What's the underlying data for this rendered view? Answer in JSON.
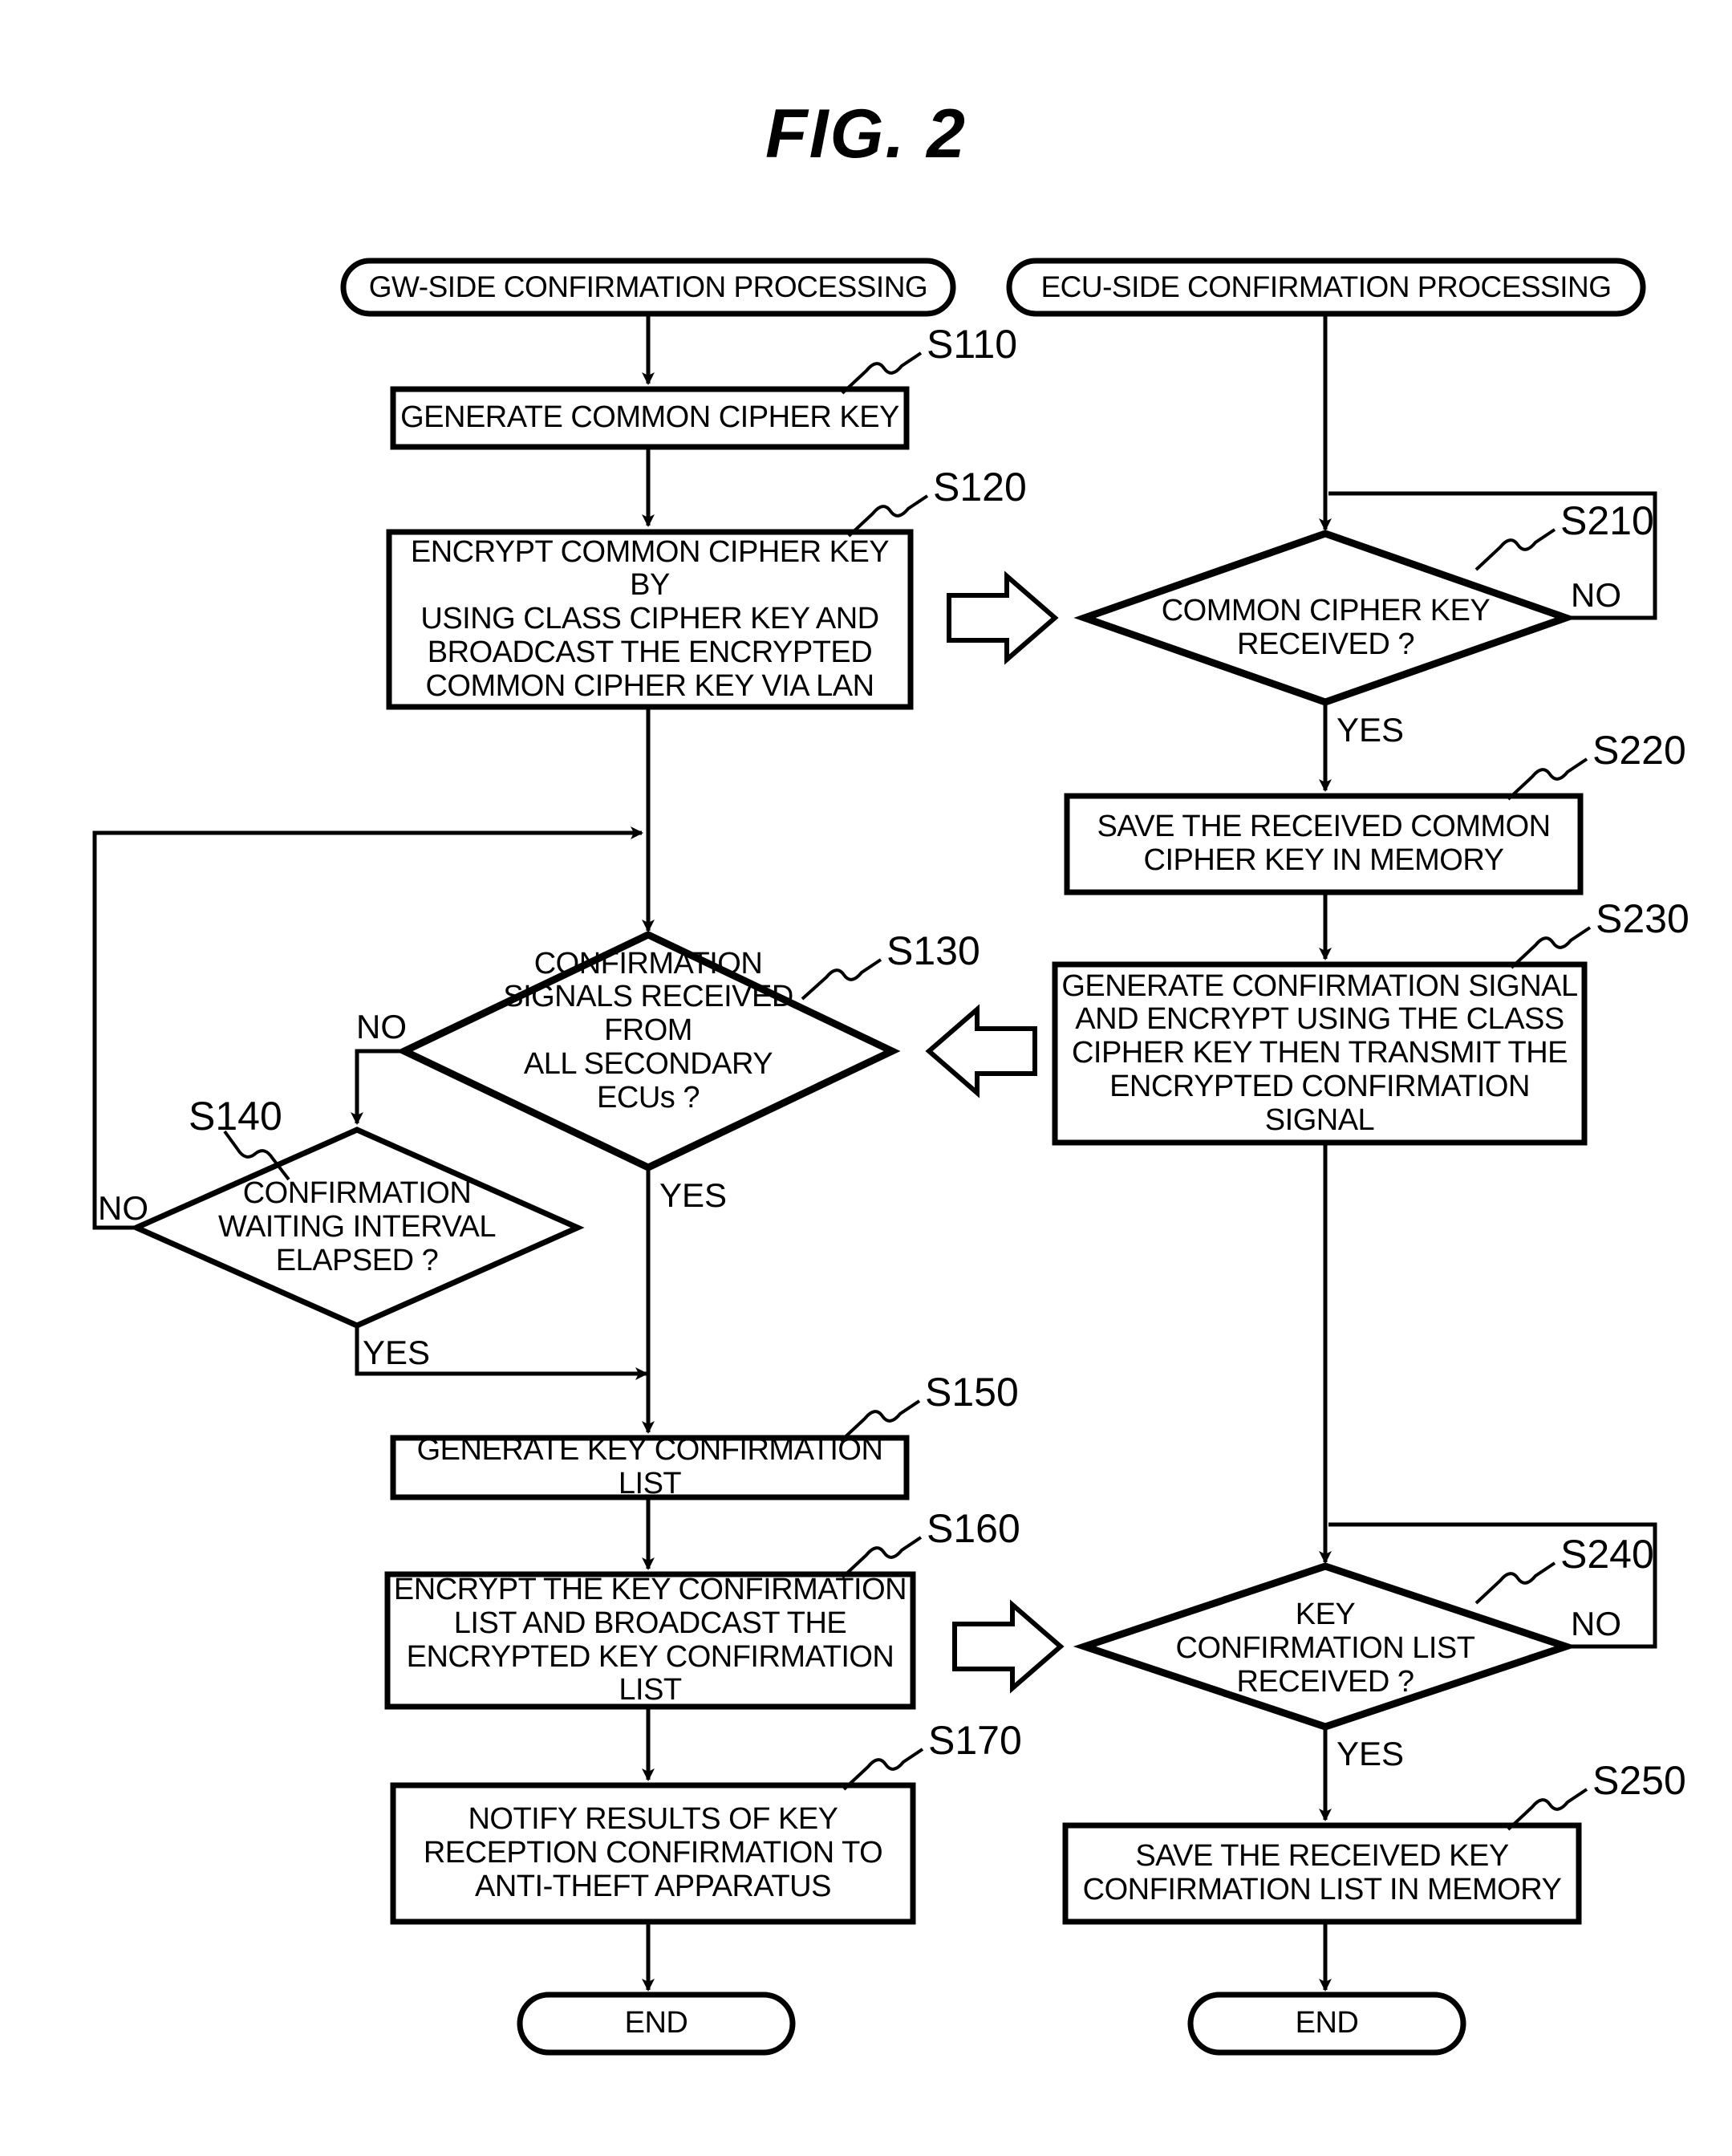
{
  "figure": {
    "title": "FIG.  2",
    "type": "flowchart",
    "lanes": [
      {
        "id": "gw",
        "start_label": "GW-SIDE CONFIRMATION PROCESSING"
      },
      {
        "id": "ecu",
        "start_label": "ECU-SIDE CONFIRMATION PROCESSING"
      }
    ]
  },
  "nodes": {
    "gw_start": {
      "shape": "terminator",
      "text": "GW-SIDE CONFIRMATION PROCESSING"
    },
    "ecu_start": {
      "shape": "terminator",
      "text": "ECU-SIDE CONFIRMATION PROCESSING"
    },
    "s110": {
      "shape": "process",
      "step": "S110",
      "text": "GENERATE COMMON CIPHER KEY"
    },
    "s120": {
      "shape": "process",
      "step": "S120",
      "text": "ENCRYPT COMMON CIPHER KEY BY\nUSING CLASS CIPHER KEY AND\nBROADCAST THE ENCRYPTED\nCOMMON CIPHER KEY VIA LAN"
    },
    "s130": {
      "shape": "decision",
      "step": "S130",
      "text": "CONFIRMATION\nSIGNALS RECEIVED FROM\nALL SECONDARY\nECUs ?",
      "yes": "YES",
      "no": "NO"
    },
    "s140": {
      "shape": "decision",
      "step": "S140",
      "text": "CONFIRMATION\nWAITING INTERVAL\nELAPSED ?",
      "yes": "YES",
      "no": "NO"
    },
    "s150": {
      "shape": "process",
      "step": "S150",
      "text": "GENERATE KEY CONFIRMATION LIST"
    },
    "s160": {
      "shape": "process",
      "step": "S160",
      "text": "ENCRYPT THE KEY CONFIRMATION\nLIST AND BROADCAST THE\nENCRYPTED KEY CONFIRMATION LIST"
    },
    "s170": {
      "shape": "process",
      "step": "S170",
      "text": "NOTIFY RESULTS OF KEY\nRECEPTION CONFIRMATION TO\nANTI-THEFT APPARATUS"
    },
    "gw_end": {
      "shape": "terminator",
      "text": "END"
    },
    "s210": {
      "shape": "decision",
      "step": "S210",
      "text": "COMMON CIPHER KEY\nRECEIVED ?",
      "yes": "YES",
      "no": "NO"
    },
    "s220": {
      "shape": "process",
      "step": "S220",
      "text": "SAVE THE RECEIVED COMMON\nCIPHER KEY IN MEMORY"
    },
    "s230": {
      "shape": "process",
      "step": "S230",
      "text": "GENERATE CONFIRMATION SIGNAL\nAND ENCRYPT USING THE CLASS\nCIPHER KEY THEN TRANSMIT THE\nENCRYPTED CONFIRMATION SIGNAL"
    },
    "s240": {
      "shape": "decision",
      "step": "S240",
      "text": "KEY\nCONFIRMATION LIST\nRECEIVED ?",
      "yes": "YES",
      "no": "NO"
    },
    "s250": {
      "shape": "process",
      "step": "S250",
      "text": "SAVE THE RECEIVED KEY\nCONFIRMATION LIST IN MEMORY"
    },
    "ecu_end": {
      "shape": "terminator",
      "text": "END"
    }
  },
  "step_labels": [
    "S110",
    "S120",
    "S130",
    "S140",
    "S150",
    "S160",
    "S170",
    "S210",
    "S220",
    "S230",
    "S240",
    "S250"
  ],
  "branch_labels": {
    "s130_no": "NO",
    "s130_yes": "YES",
    "s140_no": "NO",
    "s140_yes": "YES",
    "s210_no": "NO",
    "s210_yes": "YES",
    "s240_no": "NO",
    "s240_yes": "YES"
  },
  "colors": {
    "stroke": "#000000",
    "background": "#ffffff",
    "text": "#000000"
  },
  "cross_lane_arrows": [
    {
      "name": "s120-to-s210",
      "direction": "right",
      "style": "hollow-block"
    },
    {
      "name": "s230-to-s130",
      "direction": "left",
      "style": "hollow-block"
    },
    {
      "name": "s160-to-s240",
      "direction": "right",
      "style": "hollow-block"
    }
  ]
}
